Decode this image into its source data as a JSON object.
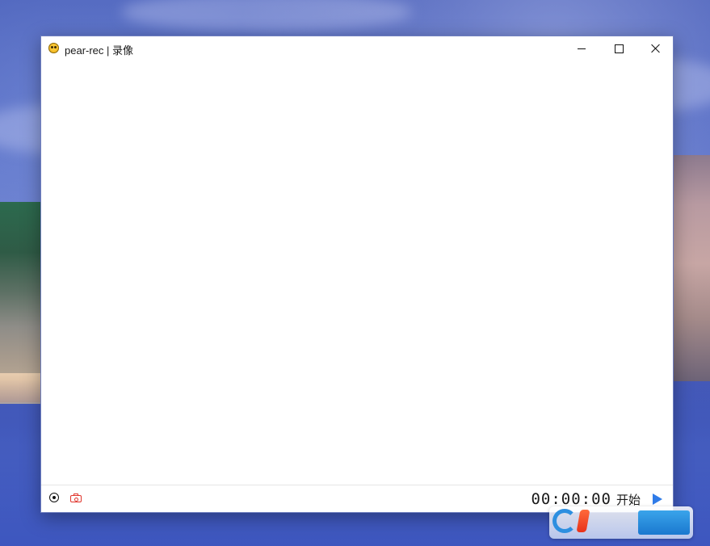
{
  "window": {
    "title": "pear-rec | 录像",
    "app_icon": "pear-rec-app-icon",
    "controls": {
      "minimize_icon": "minimize-icon",
      "maximize_icon": "maximize-icon",
      "close_icon": "close-icon"
    }
  },
  "toolbar": {
    "record_mode_icon": "record-circle-icon",
    "screenshot_icon": "camera-icon",
    "timer": "00:00:00",
    "start_label": "开始",
    "play_icon": "play-icon"
  },
  "colors": {
    "accent_play": "#2f7be8",
    "camera_red": "#e0342b",
    "window_bg": "#ffffff"
  }
}
